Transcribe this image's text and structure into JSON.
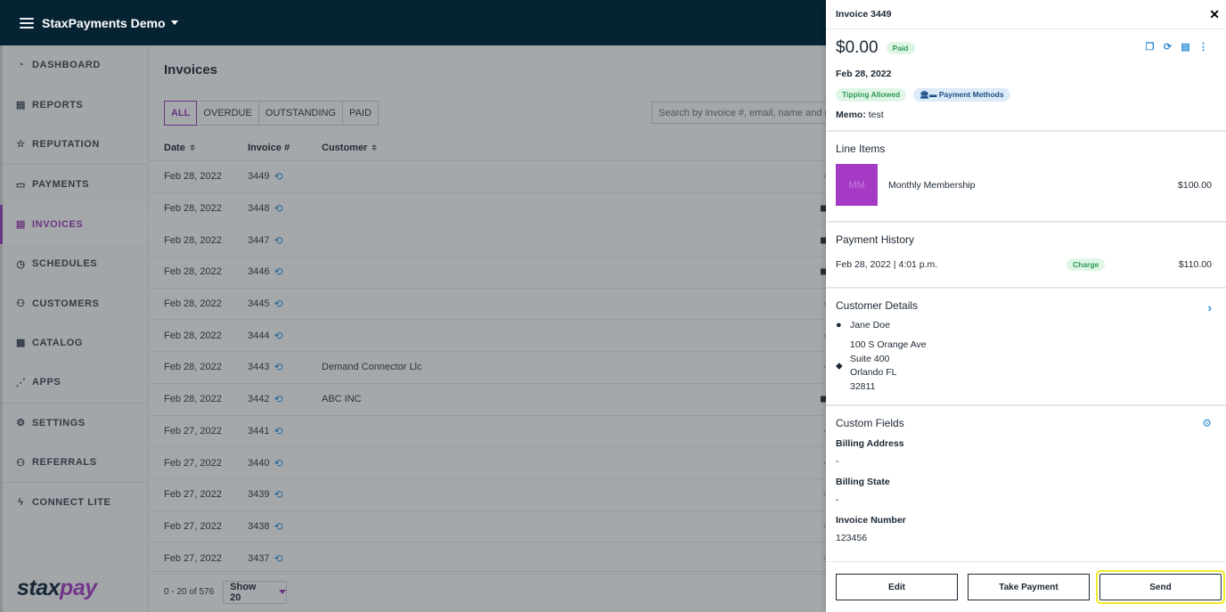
{
  "topbar": {
    "account_name": "StaxPayments Demo"
  },
  "sidebar": {
    "items": [
      {
        "label": "DASHBOARD",
        "icon": "dashboard-icon",
        "glyph": "◔"
      },
      {
        "label": "REPORTS",
        "icon": "report-icon",
        "glyph": "▤"
      },
      {
        "label": "REPUTATION",
        "icon": "star-icon",
        "glyph": "☆"
      },
      {
        "label": "PAYMENTS",
        "icon": "cash-icon",
        "glyph": "▭"
      },
      {
        "label": "INVOICES",
        "icon": "invoice-icon",
        "glyph": "▤",
        "active": true
      },
      {
        "label": "SCHEDULES",
        "icon": "clock-icon",
        "glyph": "◷"
      },
      {
        "label": "CUSTOMERS",
        "icon": "users-icon",
        "glyph": "⚇"
      },
      {
        "label": "CATALOG",
        "icon": "catalog-icon",
        "glyph": "▦"
      },
      {
        "label": "APPS",
        "icon": "apps-icon",
        "glyph": "⋰"
      },
      {
        "label": "SETTINGS",
        "icon": "settings-icon",
        "glyph": "⚙"
      },
      {
        "label": "REFERRALS",
        "icon": "referrals-icon",
        "glyph": "⚇"
      },
      {
        "label": "CONNECT LITE",
        "icon": "bolt-icon",
        "glyph": "ϟ"
      }
    ],
    "logo_part1": "stax",
    "logo_part2": "pay"
  },
  "main": {
    "title": "Invoices",
    "filters": [
      "ALL",
      "OVERDUE",
      "OUTSTANDING",
      "PAID"
    ],
    "active_filter": "ALL",
    "search_placeholder": "Search by invoice #, email, name and more",
    "columns": {
      "date": "Date",
      "invoice": "Invoice #",
      "customer": "Customer"
    },
    "rows": [
      {
        "date": "Feb 28, 2022",
        "invoice": "3449",
        "customer": "",
        "end": "chevron"
      },
      {
        "date": "Feb 28, 2022",
        "invoice": "3448",
        "customer": "",
        "end": "mail"
      },
      {
        "date": "Feb 28, 2022",
        "invoice": "3447",
        "customer": "",
        "end": "mail"
      },
      {
        "date": "Feb 28, 2022",
        "invoice": "3446",
        "customer": "",
        "end": "mail"
      },
      {
        "date": "Feb 28, 2022",
        "invoice": "3445",
        "customer": "",
        "end": "chevron"
      },
      {
        "date": "Feb 28, 2022",
        "invoice": "3444",
        "customer": "",
        "end": "chevron"
      },
      {
        "date": "Feb 28, 2022",
        "invoice": "3443",
        "customer": "Demand Connector Llc",
        "end": "chevron"
      },
      {
        "date": "Feb 28, 2022",
        "invoice": "3442",
        "customer": "ABC INC",
        "end": "mail"
      },
      {
        "date": "Feb 27, 2022",
        "invoice": "3441",
        "customer": "",
        "end": "chevron"
      },
      {
        "date": "Feb 27, 2022",
        "invoice": "3440",
        "customer": "",
        "end": "chevron"
      },
      {
        "date": "Feb 27, 2022",
        "invoice": "3439",
        "customer": "",
        "end": "chevron"
      },
      {
        "date": "Feb 27, 2022",
        "invoice": "3438",
        "customer": "",
        "end": "chevron"
      },
      {
        "date": "Feb 27, 2022",
        "invoice": "3437",
        "customer": "",
        "end": "chevron"
      }
    ],
    "pagination": {
      "range": "0 - 20 of 576",
      "per_page": "Show 20"
    }
  },
  "panel": {
    "title": "Invoice 3449",
    "amount": "$0.00",
    "status": "Paid",
    "date": "Feb 28, 2022",
    "tipping_badge": "Tipping Allowed",
    "methods_badge": "Payment Methods",
    "memo_label": "Memo:",
    "memo_value": "test",
    "line_items_title": "Line Items",
    "line_item": {
      "thumb": "MM",
      "name": "Monthly Membership",
      "price": "$100.00"
    },
    "payment_history_title": "Payment History",
    "payment": {
      "when": "Feb 28, 2022 | 4:01 p.m.",
      "type": "Charge",
      "amount": "$110.00"
    },
    "customer_title": "Customer Details",
    "customer_name": "Jane Doe",
    "address": [
      "100 S Orange Ave",
      "Suite 400",
      "Orlando FL",
      "32811"
    ],
    "custom_fields_title": "Custom Fields",
    "custom_fields": [
      {
        "label": "Billing Address",
        "value": "-"
      },
      {
        "label": "Billing State",
        "value": "-"
      },
      {
        "label": "Invoice Number",
        "value": "123456"
      }
    ],
    "buttons": {
      "edit": "Edit",
      "take_payment": "Take Payment",
      "send": "Send"
    }
  },
  "colors": {
    "brand_purple": "#9a3ab8",
    "topbar": "#062333",
    "link_blue": "#2f8fd6",
    "highlight": "#f0ea2a"
  }
}
